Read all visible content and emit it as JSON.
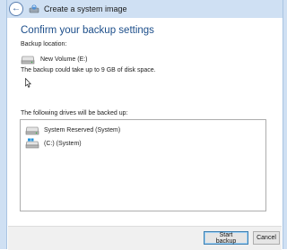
{
  "window": {
    "title": "Create a system image"
  },
  "page": {
    "heading": "Confirm your backup settings",
    "backup_location_label": "Backup location:",
    "backup_location_name": "New Volume (E:)",
    "space_note": "The backup could take up to 9 GB of disk space.",
    "drives_label": "The following drives will be backed up:",
    "drives": [
      {
        "name": "System Reserved (System)",
        "icon": "hard-drive-icon"
      },
      {
        "name": "(C:) (System)",
        "icon": "windows-drive-icon"
      }
    ]
  },
  "buttons": {
    "start_backup": "Start backup",
    "cancel": "Cancel"
  },
  "colors": {
    "heading": "#1c4e8a",
    "frame": "#cfe0f3",
    "footer": "#f0f0f0"
  }
}
